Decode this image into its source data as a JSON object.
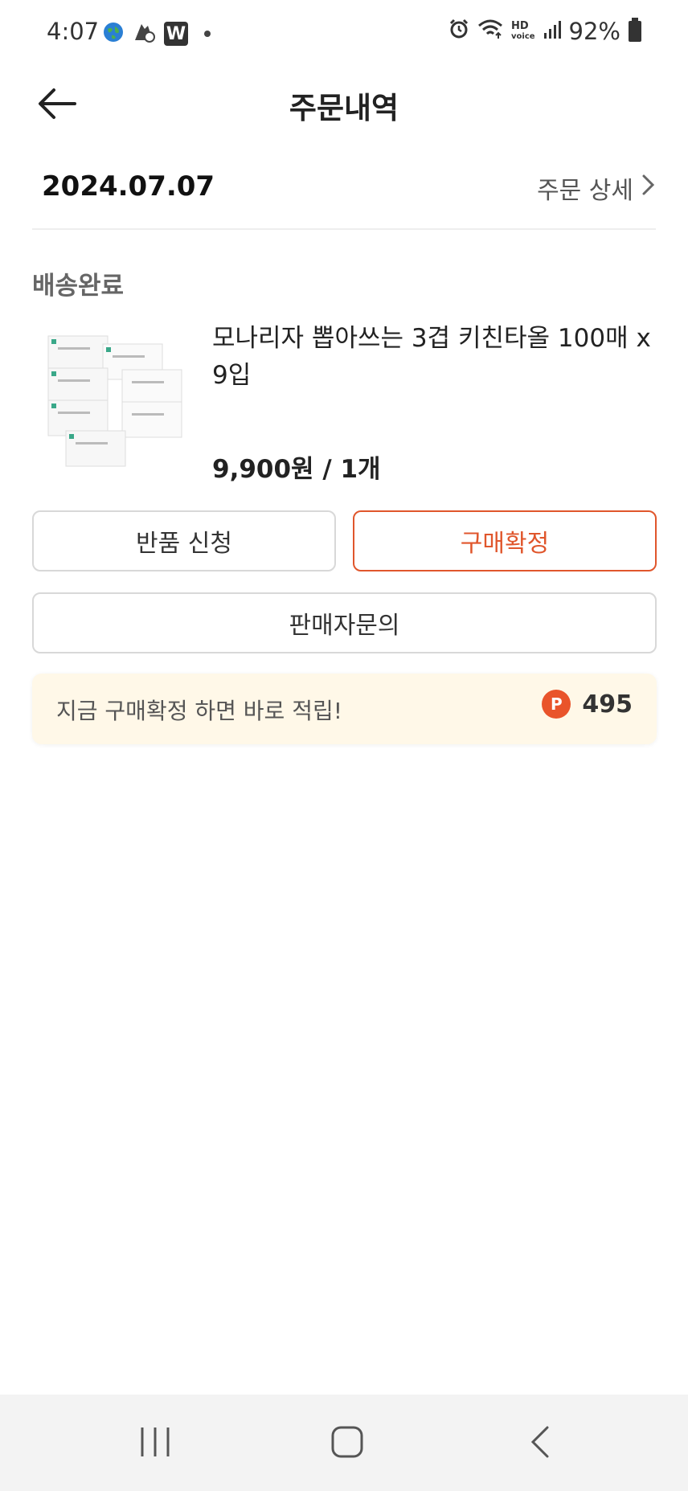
{
  "status_bar": {
    "time": "4:07",
    "battery": "92%",
    "hd_label": "HD",
    "voice_label": "voice",
    "w_badge": "W"
  },
  "header": {
    "title": "주문내역"
  },
  "order": {
    "date": "2024.07.07",
    "detail_link": "주문 상세"
  },
  "item": {
    "status": "배송완료",
    "name": "모나리자 뽑아쓰는 3겹 키친타올 100매 x 9입",
    "price": "9,900원 / 1개"
  },
  "actions": {
    "return_label": "반품 신청",
    "confirm_label": "구매확정",
    "seller_inquiry_label": "판매자문의"
  },
  "reward": {
    "message": "지금 구매확정 하면 바로 적립!",
    "point_badge": "P",
    "points": "495"
  },
  "colors": {
    "accent": "#e0562c",
    "reward_bg": "#fff8e8",
    "navbar_bg": "#f3f3f3"
  }
}
